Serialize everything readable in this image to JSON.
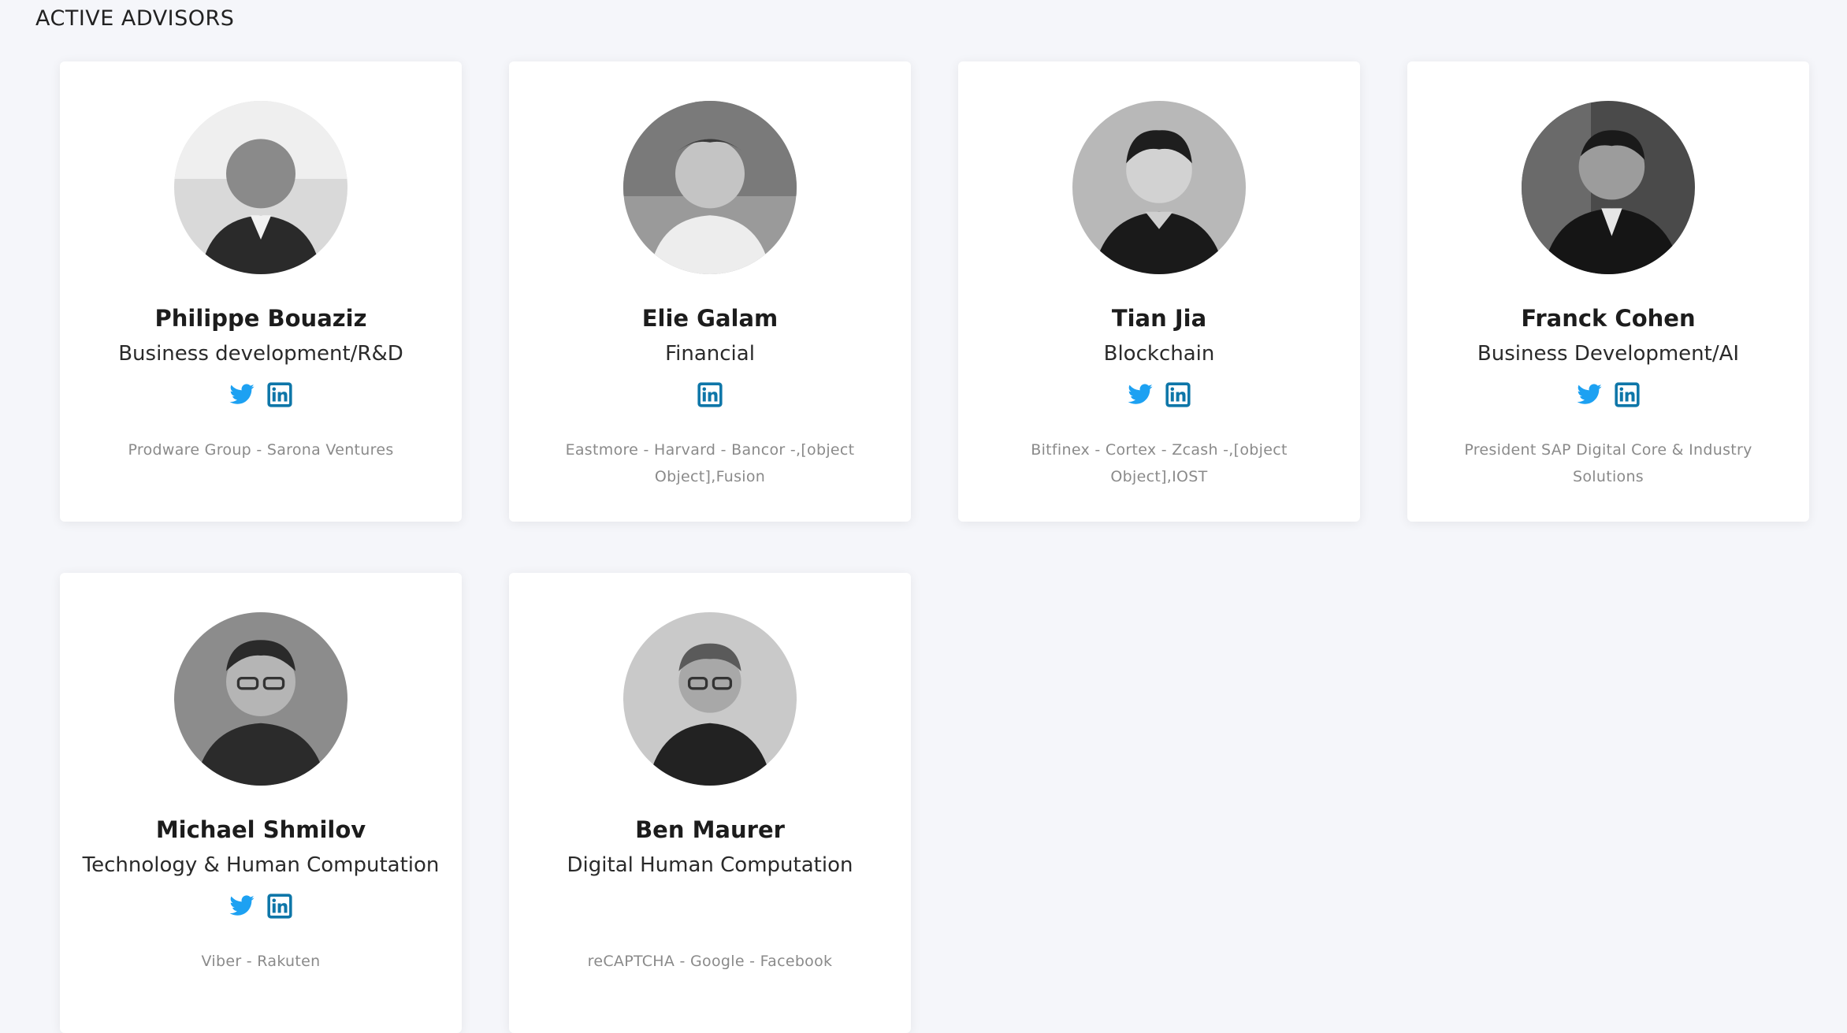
{
  "section": {
    "title": "ACTIVE ADVISORS"
  },
  "colors": {
    "twitter": "#1da1f2",
    "linkedin": "#0e76a8"
  },
  "advisors": [
    {
      "name": "Philippe Bouaziz",
      "role": "Business development/R&D",
      "twitter": true,
      "linkedin": true,
      "affiliation": "Prodware Group - Sarona Ventures"
    },
    {
      "name": "Elie Galam",
      "role": "Financial",
      "twitter": false,
      "linkedin": true,
      "affiliation": "Eastmore - Harvard - Bancor -,[object Object],Fusion"
    },
    {
      "name": "Tian Jia",
      "role": "Blockchain",
      "twitter": true,
      "linkedin": true,
      "affiliation": "Bitfinex - Cortex - Zcash -,[object Object],IOST"
    },
    {
      "name": "Franck Cohen",
      "role": "Business Development/AI",
      "twitter": true,
      "linkedin": true,
      "affiliation": "President SAP Digital Core & Industry Solutions"
    },
    {
      "name": "Michael Shmilov",
      "role": "Technology & Human Computation",
      "twitter": true,
      "linkedin": true,
      "affiliation": "Viber - Rakuten"
    },
    {
      "name": "Ben Maurer",
      "role": "Digital Human Computation",
      "twitter": false,
      "linkedin": false,
      "affiliation": "reCAPTCHA - Google - Facebook"
    }
  ]
}
